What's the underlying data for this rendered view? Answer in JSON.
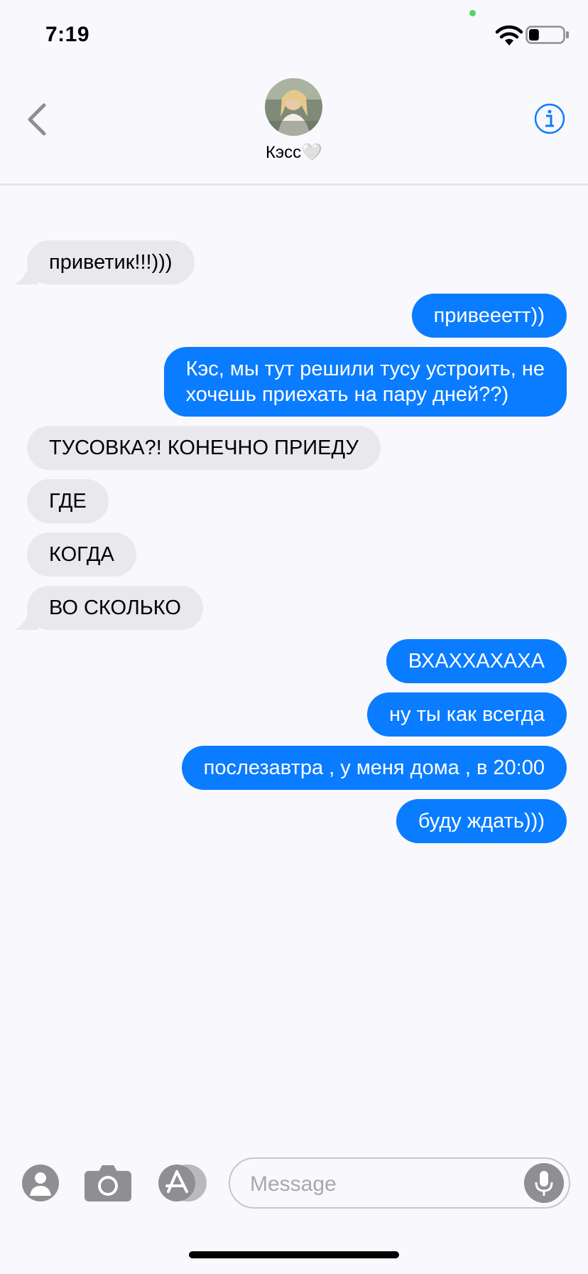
{
  "status_bar": {
    "time": "7:19",
    "battery_level": 0.3
  },
  "header": {
    "back_icon": "chevron-left-icon",
    "contact_name": "Кэсс🤍",
    "info_icon": "info-icon",
    "accent_color": "#0a7cff"
  },
  "messages": [
    {
      "direction": "in",
      "text": "приветик!!!)))"
    },
    {
      "direction": "out",
      "text": "привееетт))"
    },
    {
      "direction": "out",
      "text": "Кэс, мы тут решили тусу устроить, не\nхочешь приехать на пару дней??)"
    },
    {
      "direction": "in",
      "text": "ТУСОВКА?! КОНЕЧНО ПРИЕДУ"
    },
    {
      "direction": "in",
      "text": "ГДЕ"
    },
    {
      "direction": "in",
      "text": "КОГДА"
    },
    {
      "direction": "in",
      "text": "ВО СКОЛЬКО"
    },
    {
      "direction": "out",
      "text": "ВХАХХАХАХА"
    },
    {
      "direction": "out",
      "text": "ну ты как всегда"
    },
    {
      "direction": "out",
      "text": "послезавтра , у меня дома , в 20:00"
    },
    {
      "direction": "out",
      "text": "буду ждать)))"
    }
  ],
  "input_bar": {
    "placeholder": "Message",
    "icons": [
      "contact-icon",
      "camera-icon",
      "app-store-icon",
      "microphone-icon"
    ]
  },
  "colors": {
    "incoming_bubble": "#e9e8ed",
    "outgoing_bubble": "#0a7cff",
    "background": "#f9f8fc"
  }
}
